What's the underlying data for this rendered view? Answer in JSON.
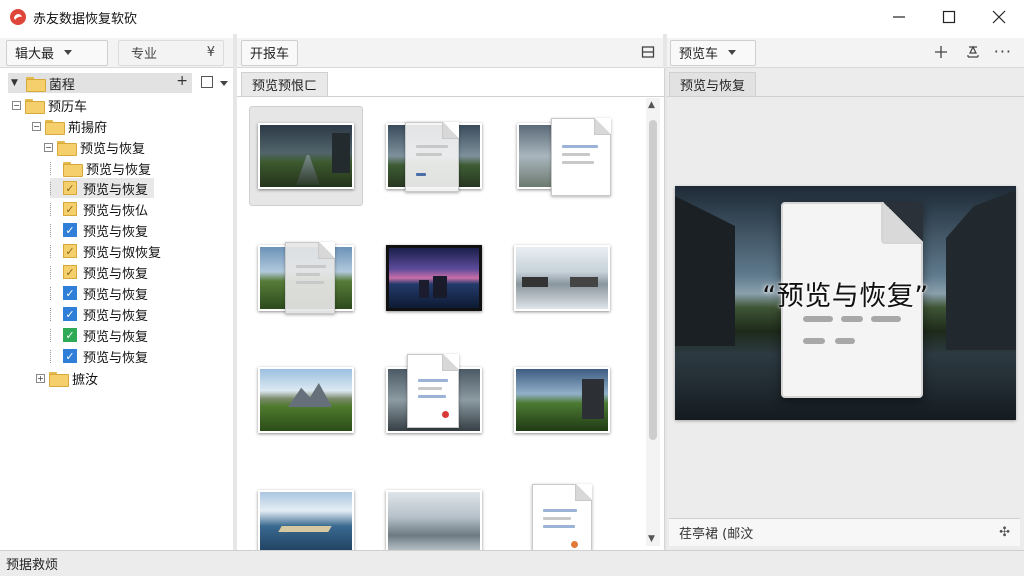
{
  "window": {
    "title": "赤友数据恢复软砍"
  },
  "left_toolbar": {
    "mode_label": "辑大最",
    "pro_label": "专业",
    "currency_glyph": "¥"
  },
  "mid_toolbar": {
    "tab_label": "开报车"
  },
  "right_toolbar": {
    "tab_label": "预览车"
  },
  "tree": {
    "root_label": "菌程",
    "items": [
      {
        "label": "预历车"
      },
      {
        "label": "荊揚府"
      },
      {
        "label": "预览与恢复"
      },
      {
        "label": "预览与恢复"
      },
      {
        "label": "预览与恢复"
      },
      {
        "label": "预览与恢仏"
      },
      {
        "label": "预览与恢复"
      },
      {
        "label": "预览与怓恢复"
      },
      {
        "label": "预览与恢复"
      },
      {
        "label": "预览与恢复"
      },
      {
        "label": "预览与恢复"
      },
      {
        "label": "预览与恢复"
      },
      {
        "label": "预览与恢复"
      },
      {
        "label": "预览与恢复"
      },
      {
        "label": "摭汝"
      }
    ]
  },
  "middle": {
    "subtab_label": "预览预恨ㄈ"
  },
  "right": {
    "subtab_label": "预览与恢复",
    "preview_caption": "“预览与恢复”",
    "status_text": "荏亭裙 (邮汶"
  },
  "statusbar": {
    "text": "预据救烦"
  },
  "colors": {
    "accent": "#2f7fd8",
    "check_green": "#2eaa56",
    "folder": "#f4cf6b",
    "app_icon": "#e0453a"
  }
}
